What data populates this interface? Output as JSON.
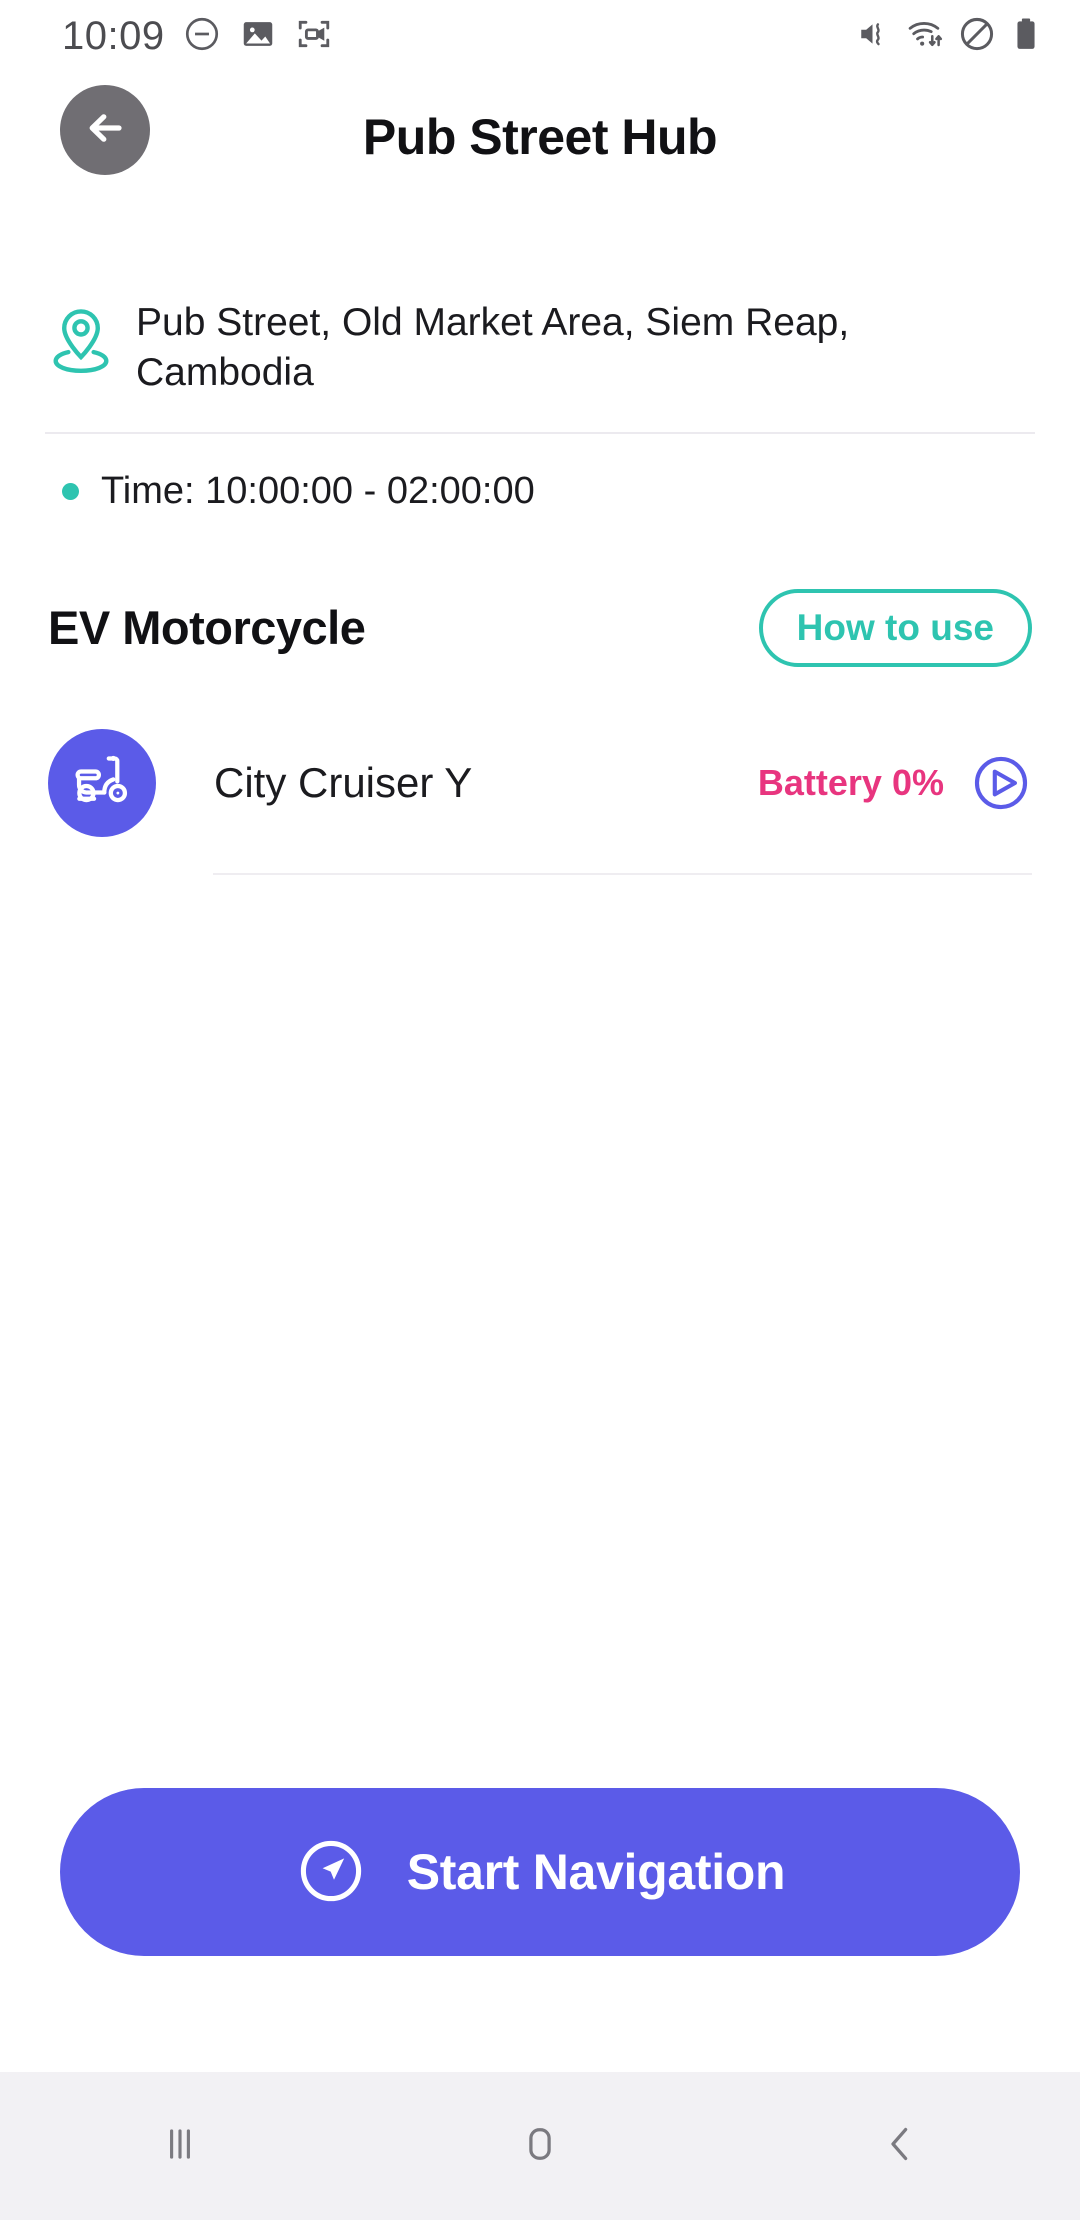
{
  "status_bar": {
    "time": "10:09",
    "left_icons": [
      "minus-circle-icon",
      "gallery-icon",
      "screen-recorder-icon"
    ],
    "right_icons": [
      "mute-vibrate-icon",
      "wifi-data-icon",
      "do-not-disturb-icon",
      "battery-full-icon"
    ]
  },
  "app_bar": {
    "back_icon": "arrow-left-icon",
    "title": "Pub Street Hub"
  },
  "station": {
    "location_icon": "location-pin-icon",
    "address": "Pub Street, Old Market Area, Siem Reap, Cambodia",
    "hours": "Time: 10:00:00 - 02:00:00"
  },
  "section": {
    "title": "EV Motorcycle",
    "how_to_use_label": "How to use"
  },
  "vehicles": [
    {
      "icon": "scooter-icon",
      "name": "City Cruiser Y",
      "battery": "Battery 0%",
      "play_icon": "play-circle-icon"
    }
  ],
  "cta": {
    "icon": "navigation-arrow-icon",
    "label": "Start Navigation"
  },
  "nav_bar": {
    "recents": "recents-icon",
    "home": "home-icon",
    "back": "back-chevron-icon"
  },
  "colors": {
    "accent_teal": "#2EC4B0",
    "accent_purple": "#5B5BE8",
    "battery_pink": "#E8357F",
    "text_dark": "#1B1B1F",
    "divider": "#ECEAEF",
    "navbar_bg": "#F2F1F4"
  }
}
